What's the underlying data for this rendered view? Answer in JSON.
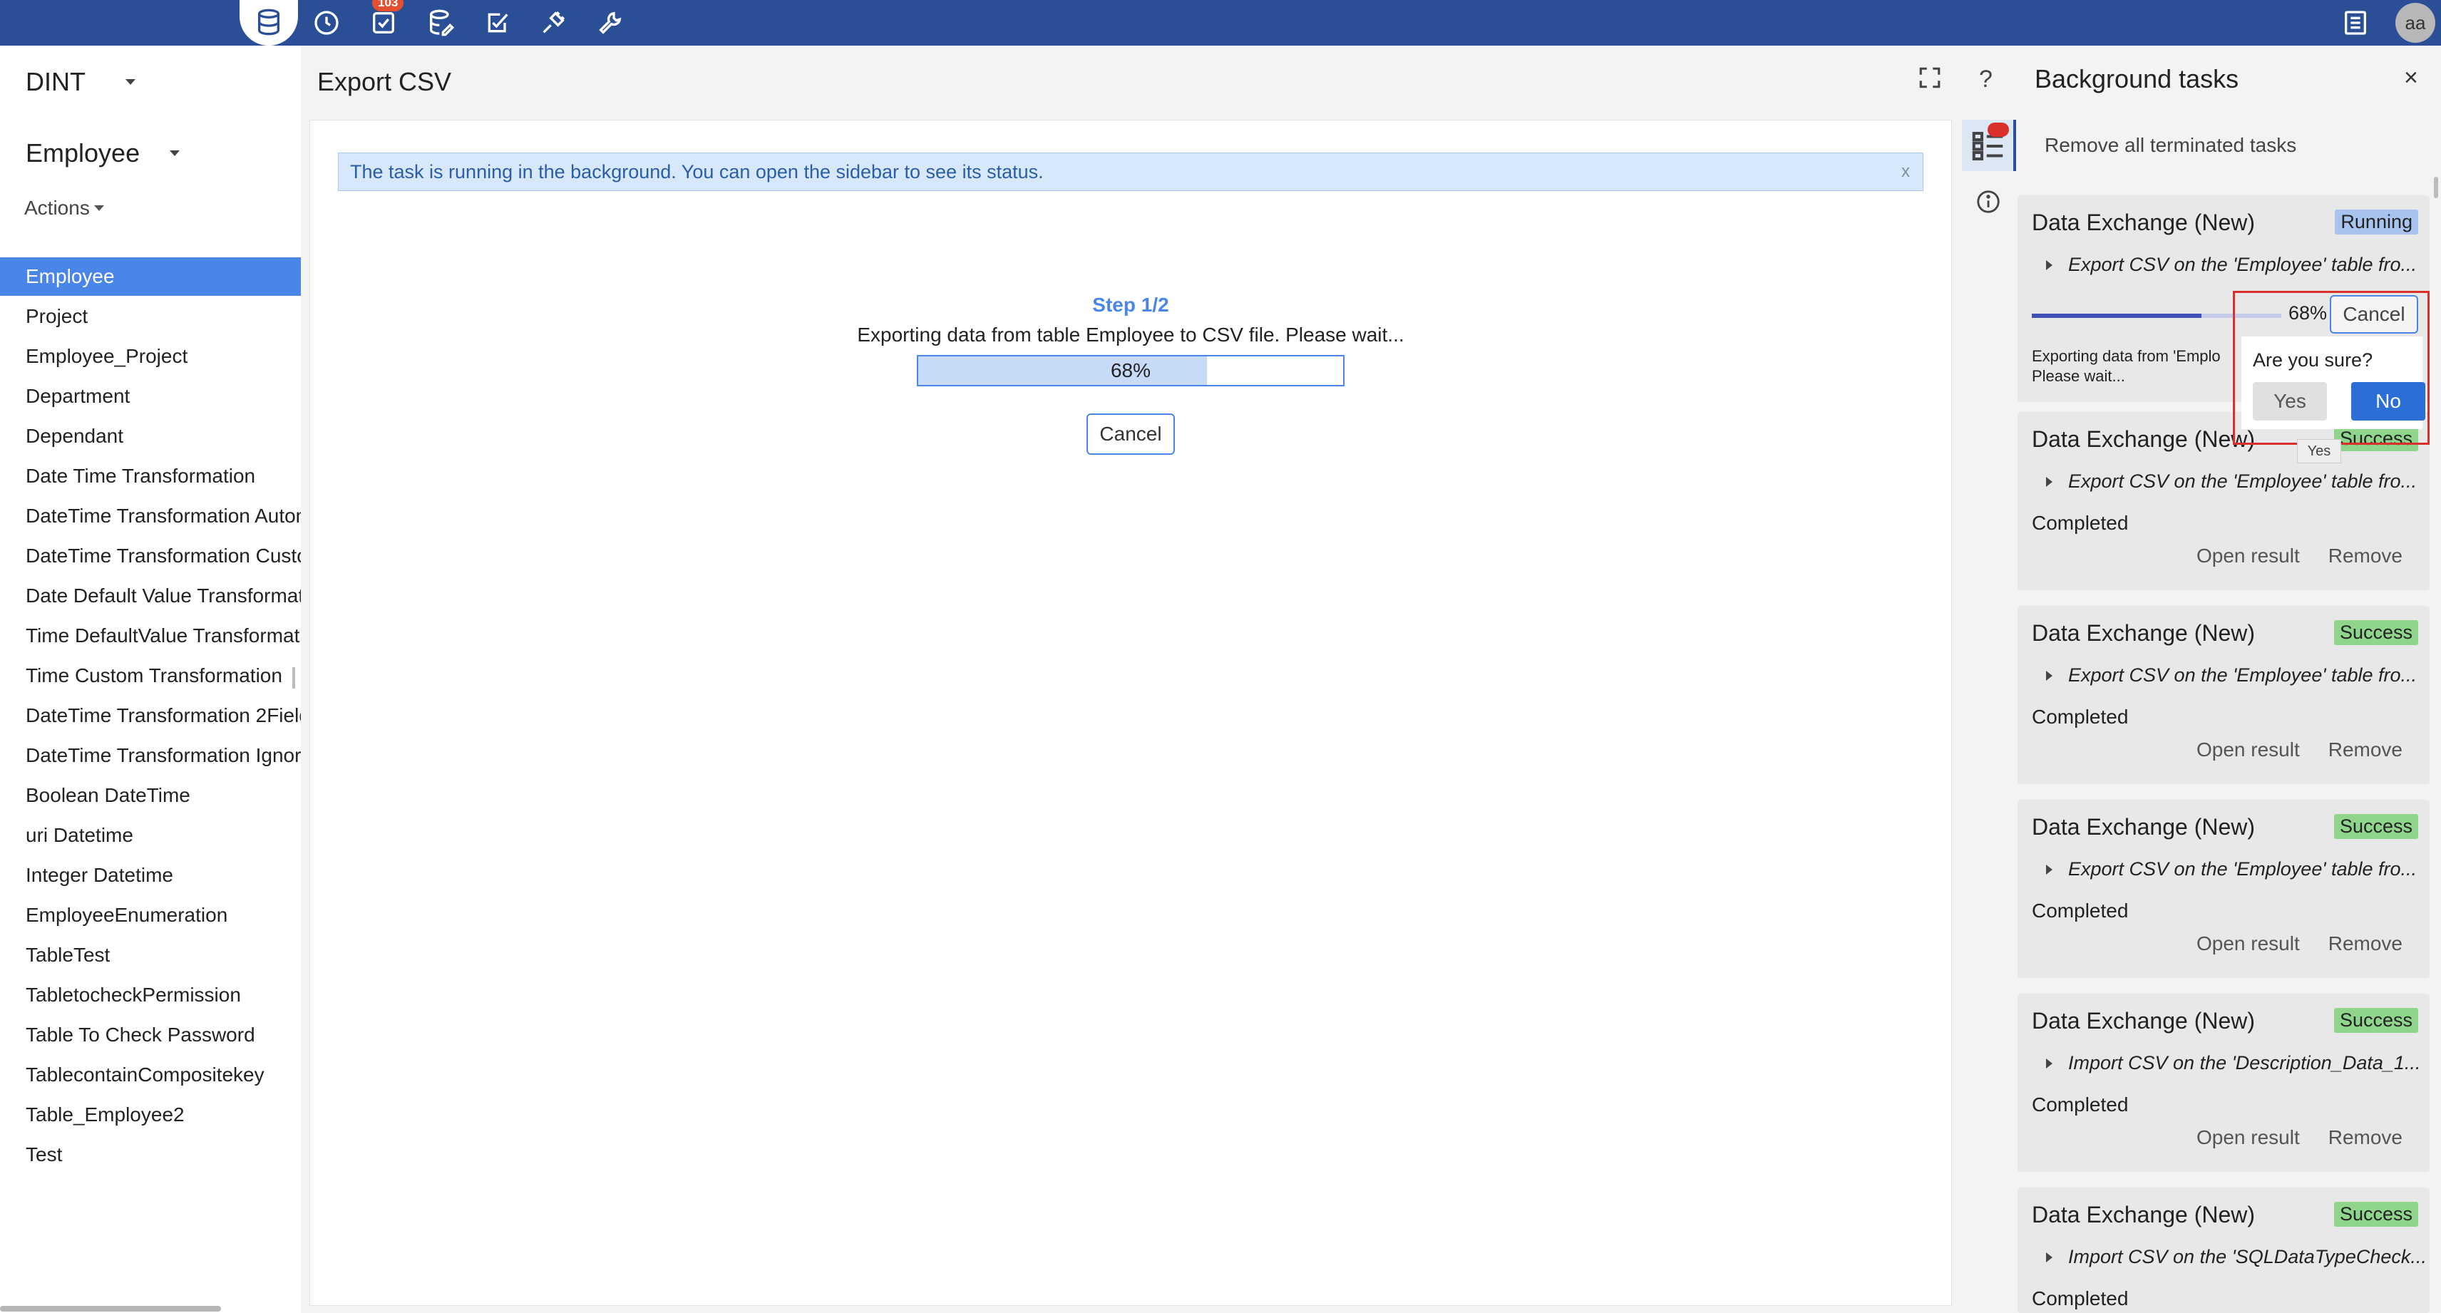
{
  "topbar": {
    "icons": [
      "database-icon",
      "history-icon",
      "tasks-check-icon",
      "database-edit-icon",
      "checklist-edit-icon",
      "plugin-icon",
      "wrench-icon",
      "list-icon"
    ],
    "badge": "103",
    "avatar": "aa",
    "bar_color": "#2a4f96"
  },
  "sidebar": {
    "project": "DINT",
    "table": "Employee",
    "actions": "Actions",
    "items": [
      "Employee",
      "Project",
      "Employee_Project",
      "Department",
      "Dependant",
      "Date Time Transformation",
      "DateTime Transformation Autom",
      "DateTime Transformation Custo",
      "Date Default Value Transformat",
      "Time DefaultValue Transformati",
      "Time Custom Transformation",
      "DateTime Transformation 2Field",
      "DateTime Transformation Ignore",
      "Boolean DateTime",
      "uri Datetime",
      "Integer Datetime",
      "EmployeeEnumeration",
      "TableTest",
      "TabletocheckPermission",
      "Table To Check Password",
      "TablecontainCompositekey",
      "Table_Employee2",
      "Test"
    ],
    "active_color": "#4a86e8"
  },
  "main": {
    "title": "Export CSV",
    "help": "?",
    "banner": "The task is running in the background. You can open the sidebar to see its status.",
    "banner_close": "x",
    "step": "Step 1/2",
    "message": "Exporting data from table Employee to CSV file. Please wait...",
    "progress_value": 68,
    "progress_label": "68%",
    "cancel": "Cancel"
  },
  "panel": {
    "title": "Background tasks",
    "close": "×",
    "remove_all": "Remove all terminated tasks",
    "running_task": {
      "title": "Data Exchange (New)",
      "badge": "Running",
      "subtitle": "Export CSV on the 'Employee' table fro...",
      "progress_value": 68,
      "progress_label": "68%",
      "cancel": "Cancel",
      "message_line1": "Exporting data from 'Emplo",
      "message_line2": "Please wait..."
    },
    "tasks": [
      {
        "title": "Data Exchange (New)",
        "badge": "Success",
        "subtitle": "Export CSV on the 'Employee' table fro...",
        "status": "Completed",
        "open": "Open result",
        "remove": "Remove"
      },
      {
        "title": "Data Exchange (New)",
        "badge": "Success",
        "subtitle": "Export CSV on the 'Employee' table fro...",
        "status": "Completed",
        "open": "Open result",
        "remove": "Remove"
      },
      {
        "title": "Data Exchange (New)",
        "badge": "Success",
        "subtitle": "Export CSV on the 'Employee' table fro...",
        "status": "Completed",
        "open": "Open result",
        "remove": "Remove"
      },
      {
        "title": "Data Exchange (New)",
        "badge": "Success",
        "subtitle": "Import CSV on the 'Description_Data_1...",
        "status": "Completed",
        "open": "Open result",
        "remove": "Remove"
      },
      {
        "title": "Data Exchange (New)",
        "badge": "Success",
        "subtitle": "Import CSV on the 'SQLDataTypeCheck...",
        "status": "Completed",
        "open": "",
        "remove": ""
      }
    ],
    "confirm": {
      "question": "Are you sure?",
      "yes": "Yes",
      "no": "No",
      "tooltip": "Yes"
    }
  }
}
